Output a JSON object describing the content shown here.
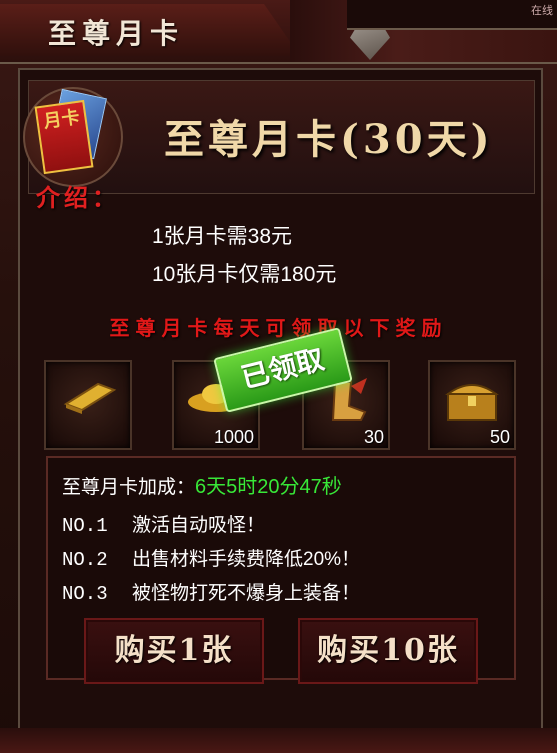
{
  "window": {
    "title": "至尊月卡",
    "corner_text": "在线"
  },
  "header": {
    "card_icon_text": "月卡",
    "title": "至尊月卡(30天)"
  },
  "intro": {
    "label": "介绍：",
    "line1": "1张月卡需38元",
    "line2": "10张月卡仅需180元"
  },
  "rewards": {
    "heading": "至尊月卡每天可领取以下奖励",
    "claimed_stamp": "已领取",
    "items": [
      {
        "icon": "gold-bar-icon",
        "count": ""
      },
      {
        "icon": "gold-ingot-icon",
        "count": "1000"
      },
      {
        "icon": "wing-boot-icon",
        "count": "30"
      },
      {
        "icon": "treasure-chest-icon",
        "count": "50"
      }
    ]
  },
  "bonus": {
    "label": "至尊月卡加成：",
    "timer": "6天5时20分47秒",
    "perks": [
      {
        "no": "NO.1",
        "text": "激活自动吸怪！"
      },
      {
        "no": "NO.2",
        "text": "出售材料手续费降低20%！"
      },
      {
        "no": "NO.3",
        "text": "被怪物打死不爆身上装备！"
      }
    ]
  },
  "buttons": {
    "buy_one": "购买1张",
    "buy_ten": "购买10张"
  },
  "colors": {
    "title": "#f0d8a8",
    "intro_label": "#e02020",
    "timer": "#38e838",
    "stamp": "#3aa820"
  }
}
